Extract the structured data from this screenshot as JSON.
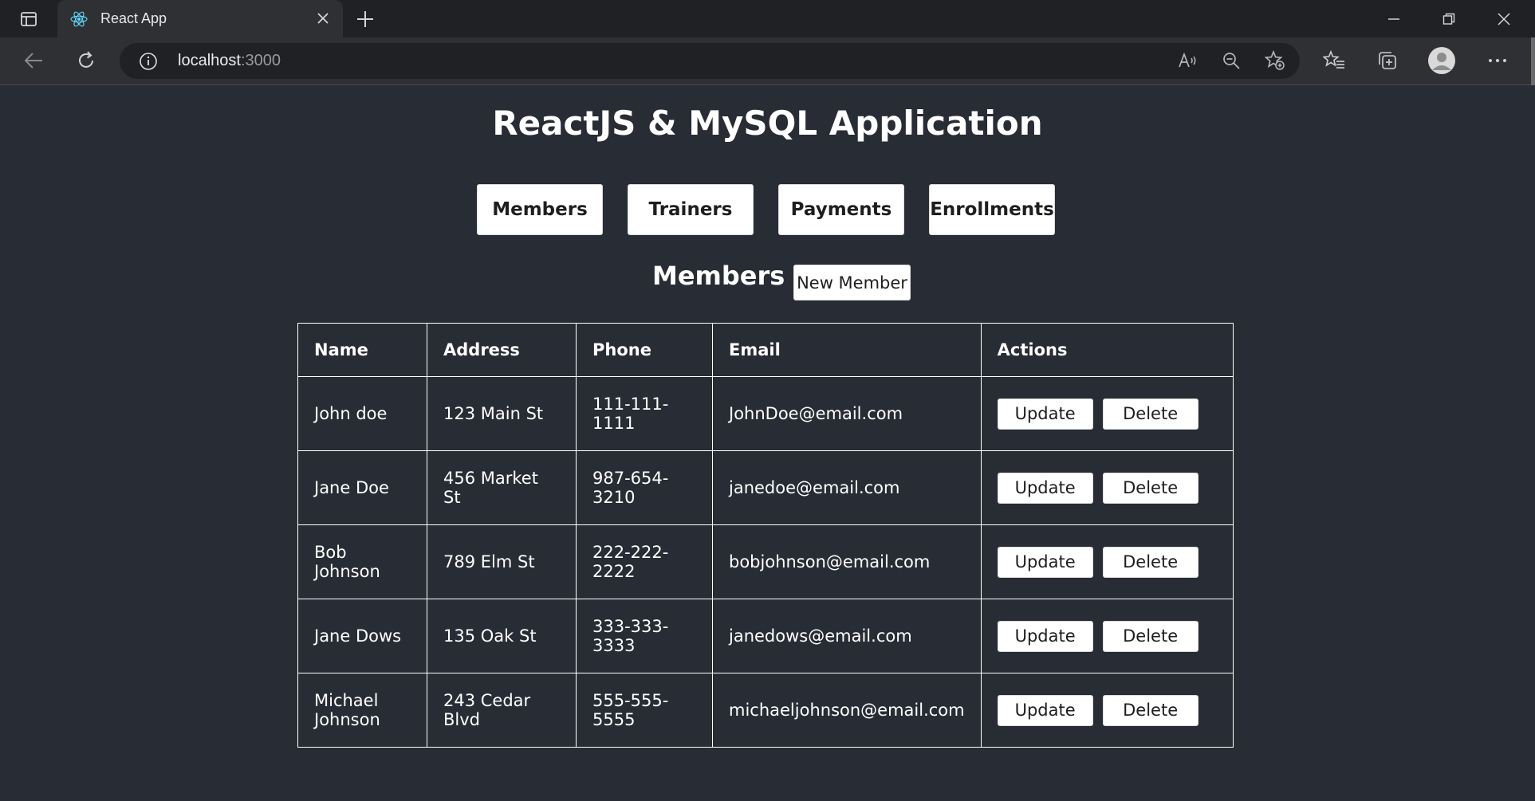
{
  "browser": {
    "tab_title": "React App",
    "url_host": "localhost",
    "url_port": ":3000"
  },
  "app": {
    "title": "ReactJS & MySQL Application",
    "nav": [
      "Members",
      "Trainers",
      "Payments",
      "Enrollments"
    ],
    "section_title": "Members",
    "new_button": "New Member"
  },
  "table": {
    "columns": [
      "Name",
      "Address",
      "Phone",
      "Email",
      "Actions"
    ],
    "rows": [
      {
        "name": "John doe",
        "address": "123 Main St",
        "phone": "111-111-1111",
        "email": "JohnDoe@email.com"
      },
      {
        "name": "Jane Doe",
        "address": "456 Market St",
        "phone": "987-654-3210",
        "email": "janedoe@email.com"
      },
      {
        "name": "Bob Johnson",
        "address": "789 Elm St",
        "phone": "222-222-2222",
        "email": "bobjohnson@email.com"
      },
      {
        "name": "Jane Dows",
        "address": "135 Oak St",
        "phone": "333-333-3333",
        "email": "janedows@email.com"
      },
      {
        "name": "Michael Johnson",
        "address": "243 Cedar Blvd",
        "phone": "555-555-5555",
        "email": "michaeljohnson@email.com"
      }
    ],
    "update_label": "Update",
    "delete_label": "Delete"
  },
  "colors": {
    "page_bg": "#282c34",
    "button_bg": "#ffffff",
    "react_logo": "#61dafb"
  }
}
